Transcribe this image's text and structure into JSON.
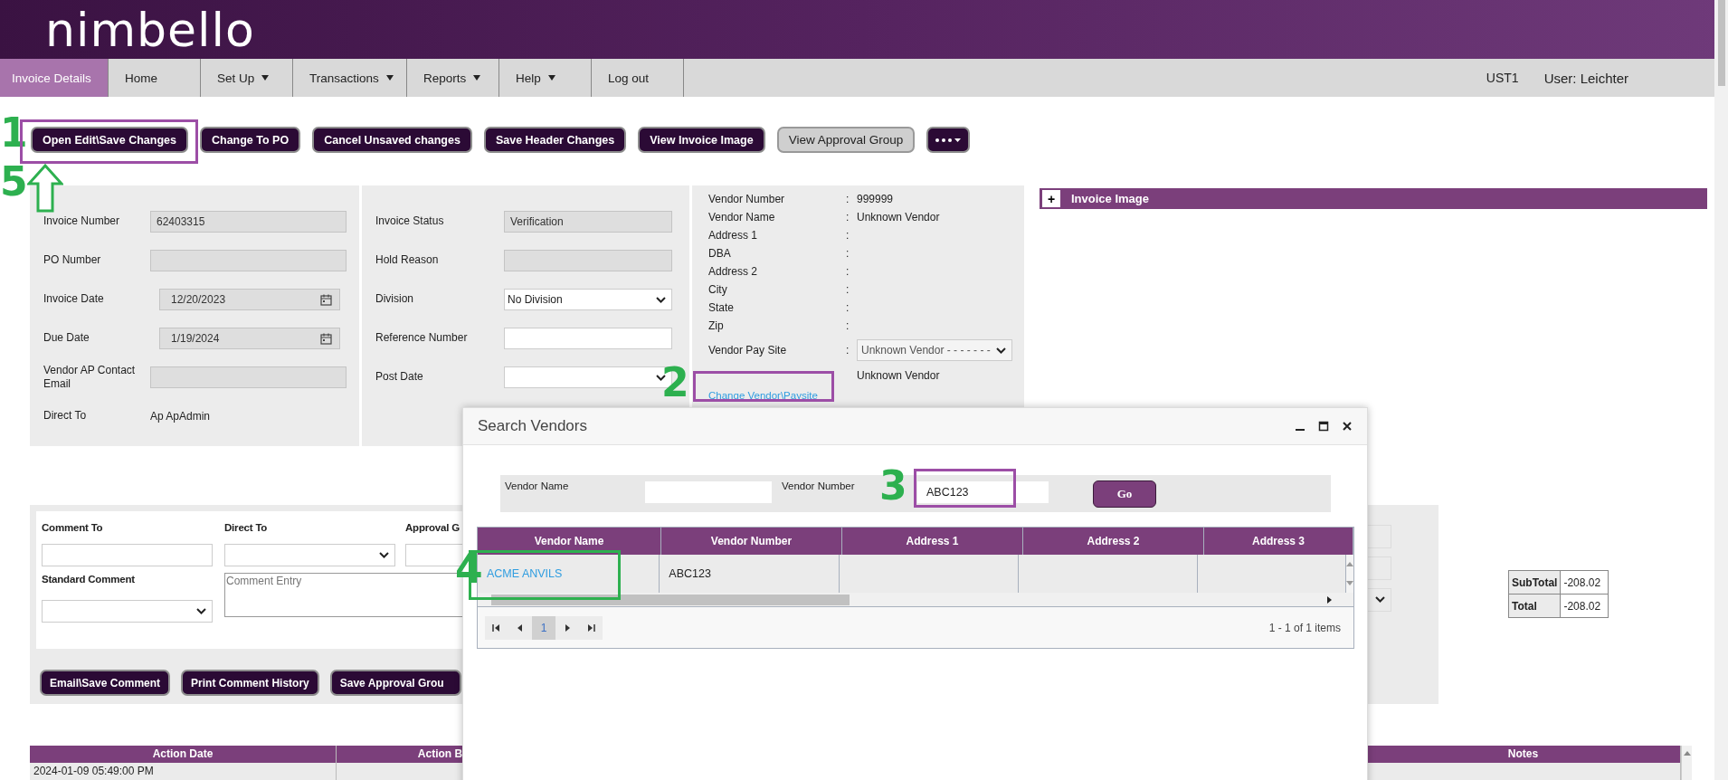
{
  "logo": "nimbello",
  "nav": {
    "items": [
      {
        "label": "Invoice Details",
        "selected": true,
        "dropdown": false
      },
      {
        "label": "Home",
        "selected": false,
        "dropdown": false
      },
      {
        "label": "Set Up",
        "selected": false,
        "dropdown": true
      },
      {
        "label": "Transactions",
        "selected": false,
        "dropdown": true
      },
      {
        "label": "Reports",
        "selected": false,
        "dropdown": true
      },
      {
        "label": "Help",
        "selected": false,
        "dropdown": true
      },
      {
        "label": "Log out",
        "selected": false,
        "dropdown": false
      }
    ],
    "environment": "UST1",
    "user": "User: Leichter"
  },
  "toolbar": [
    {
      "label": "Open Edit\\Save Changes",
      "kind": "action"
    },
    {
      "label": "Change To PO",
      "kind": "action"
    },
    {
      "label": "Cancel Unsaved changes",
      "kind": "action"
    },
    {
      "label": "Save Header Changes",
      "kind": "action"
    },
    {
      "label": "View Invoice Image",
      "kind": "action"
    },
    {
      "label": "View Approval Group",
      "kind": "secondary"
    },
    {
      "kind": "more"
    }
  ],
  "invoice_form": {
    "columns": [
      [
        {
          "label": "Invoice Number",
          "kind": "text",
          "value": "62403315",
          "readonly": true
        },
        {
          "label": "PO Number",
          "kind": "text",
          "readonly": true
        },
        {
          "label": "Invoice Date",
          "kind": "date",
          "value": "12/20/2023",
          "readonly": true
        },
        {
          "label": "Due Date",
          "kind": "date",
          "value": "1/19/2024",
          "readonly": true
        },
        {
          "label": "Vendor AP Contact Email",
          "kind": "text",
          "readonly": true
        },
        {
          "label": "Direct To",
          "kind": "static",
          "value": "Ap ApAdmin"
        }
      ],
      [
        {
          "label": "Invoice Status",
          "kind": "text",
          "value": "Verification",
          "readonly": true
        },
        {
          "label": "Hold Reason",
          "kind": "text",
          "readonly": true
        },
        {
          "label": "Division",
          "kind": "select",
          "value": "No Division",
          "readonly": false
        },
        {
          "label": "Reference Number",
          "kind": "text",
          "readonly": false
        },
        {
          "label": "Post Date",
          "kind": "select",
          "readonly": false
        }
      ]
    ]
  },
  "vendor": {
    "rows": [
      {
        "label": "Vendor Number",
        "sep": ":",
        "value": "999999"
      },
      {
        "label": "Vendor Name",
        "sep": ":",
        "value": "Unknown Vendor"
      },
      {
        "label": "Address 1",
        "sep": ":"
      },
      {
        "label": "DBA",
        "sep": ":"
      },
      {
        "label": "Address 2",
        "sep": ":"
      },
      {
        "label": "City",
        "sep": ":"
      },
      {
        "label": "State",
        "sep": ":"
      },
      {
        "label": "Zip",
        "sep": ":"
      }
    ],
    "pay_site": {
      "label": "Vendor Pay Site",
      "sep": ":",
      "value": "Unknown Vendor - - - - - - -",
      "note": "Unknown Vendor"
    },
    "change_link": "Change Vendor\\Paysite"
  },
  "invoice_image": {
    "toggle": "+",
    "title": "Invoice Image"
  },
  "comments": {
    "comment_to": "Comment To",
    "direct_to": "Direct To",
    "approval": "Approval G",
    "standard_comment": "Standard Comment",
    "entry_placeholder": "Comment Entry",
    "buttons": [
      "Email\\Save Comment",
      "Print Comment History",
      "Save Approval Grou"
    ]
  },
  "totals": [
    {
      "label": "SubTotal",
      "value": "-208.02"
    },
    {
      "label": "Total",
      "value": "-208.02"
    }
  ],
  "history": {
    "columns": [
      "Action Date",
      "Action B",
      "Notes"
    ],
    "rows": [
      {
        "action_date": "2024-01-09 05:49:00 PM"
      }
    ]
  },
  "dialog": {
    "title": "Search Vendors",
    "search": [
      {
        "label": "Vendor Name"
      },
      {
        "label": "Vendor Number",
        "value": "ABC123"
      }
    ],
    "go": "Go",
    "columns": [
      "Vendor Name",
      "Vendor Number",
      "Address 1",
      "Address 2",
      "Address 3"
    ],
    "rows": [
      {
        "vendor_name": "ACME ANVILS",
        "vendor_number": "ABC123"
      }
    ],
    "pages": [
      {
        "label": "1",
        "selected": true
      }
    ],
    "summary": "1 - 1 of 1 items"
  },
  "annotations": [
    {
      "number": "1",
      "kind": "box",
      "color": "#9c4ea6"
    },
    {
      "number": "2",
      "kind": "box",
      "color": "#9c4ea6"
    },
    {
      "number": "3",
      "kind": "box",
      "color": "#9c4ea6"
    },
    {
      "number": "4",
      "kind": "box",
      "color": "#2db04f"
    },
    {
      "number": "5",
      "kind": "arrow"
    }
  ]
}
